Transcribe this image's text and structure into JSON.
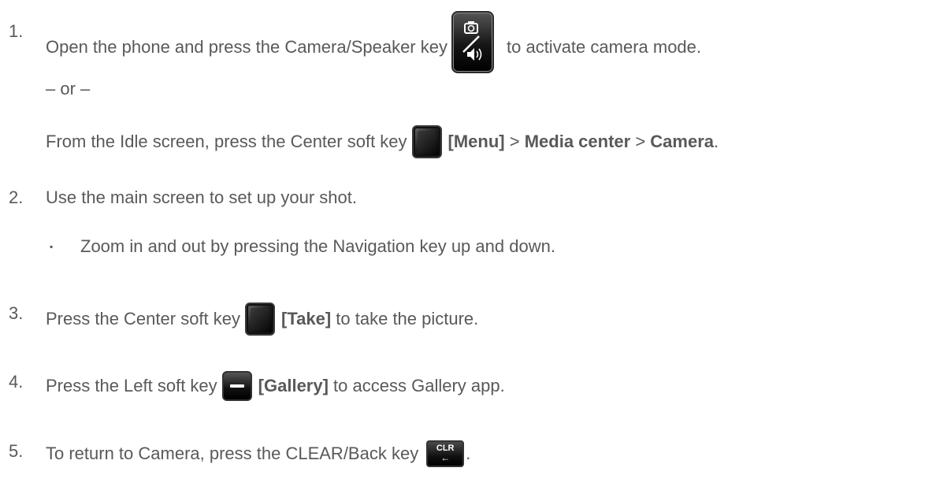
{
  "steps": [
    {
      "number": "1.",
      "before": "Open the phone and press the Camera/Speaker key",
      "icon": "camera-speaker-key-icon",
      "after": "to activate camera mode."
    },
    {
      "or_text": "– or –"
    },
    {
      "prefix": "From the Idle screen, press the Center soft key",
      "icon": "center-soft-key-icon",
      "menu": "[Menu]",
      "sep1": " > ",
      "media": "Media center",
      "sep2": " > ",
      "camera": "Camera",
      "end": "."
    },
    {
      "number": "2.",
      "text": "Use the main screen to set up your shot.",
      "bullet": "▪",
      "sub": "Zoom in and out by pressing the Navigation key up and down."
    },
    {
      "number": "3.",
      "before": "Press the Center soft key",
      "icon": "center-soft-key-icon",
      "bold": "[Take]",
      "after": " to take the picture."
    },
    {
      "number": "4.",
      "before": "Press the Left soft key",
      "icon": "left-soft-key-icon",
      "bold": "[Gallery]",
      "after": " to access Gallery app."
    },
    {
      "number": "5.",
      "before": "To return to Camera, press the CLEAR/Back key",
      "icon": "clear-back-key-icon",
      "key_label": "CLR",
      "after": "."
    }
  ]
}
